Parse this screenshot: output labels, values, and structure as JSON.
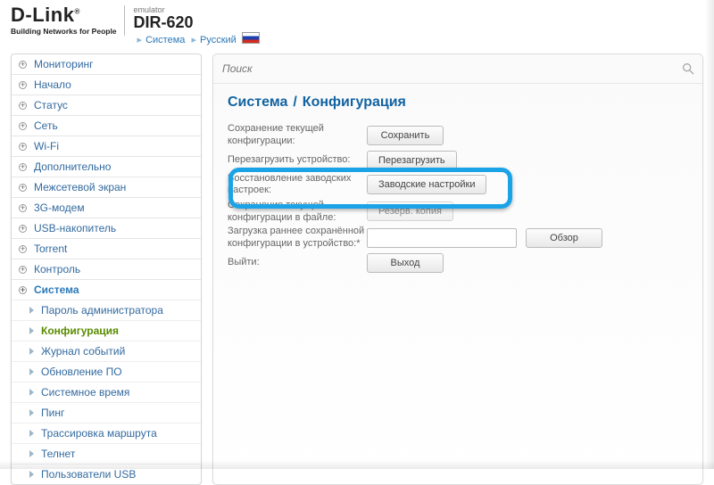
{
  "header": {
    "logo": "D-Link",
    "logo_sup": "®",
    "logo_tagline": "Building Networks for People",
    "emulator_label": "emulator",
    "model": "DIR-620",
    "breadcrumb_system": "Система",
    "breadcrumb_lang": "Русский"
  },
  "search": {
    "placeholder": "Поиск"
  },
  "sidebar": {
    "items": [
      "Мониторинг",
      "Начало",
      "Статус",
      "Сеть",
      "Wi-Fi",
      "Дополнительно",
      "Межсетевой экран",
      "3G-модем",
      "USB-накопитель",
      "Torrent",
      "Контроль",
      "Система"
    ],
    "sub_items": [
      "Пароль администратора",
      "Конфигурация",
      "Журнал событий",
      "Обновление ПО",
      "Системное время",
      "Пинг",
      "Трассировка маршрута",
      "Телнет",
      "Пользователи USB"
    ],
    "current_sub_index": 1
  },
  "content": {
    "title_left": "Система",
    "title_right": "Конфигурация",
    "rows": {
      "save": {
        "label": "Сохранение текущей конфигурации:",
        "button": "Сохранить"
      },
      "reboot": {
        "label": "Перезагрузить устройство:",
        "button": "Перезагрузить"
      },
      "factory": {
        "label": "Восстановление заводских настроек:",
        "button": "Заводские настройки"
      },
      "backup": {
        "label": "Сохранение текущей конфигурации в файле:",
        "button": "Резерв. копия"
      },
      "restore": {
        "label": "Загрузка раннее сохранённой конфигурации в устройство:*",
        "button": "Обзор"
      },
      "exit": {
        "label": "Выйти:",
        "button": "Выход"
      }
    }
  }
}
